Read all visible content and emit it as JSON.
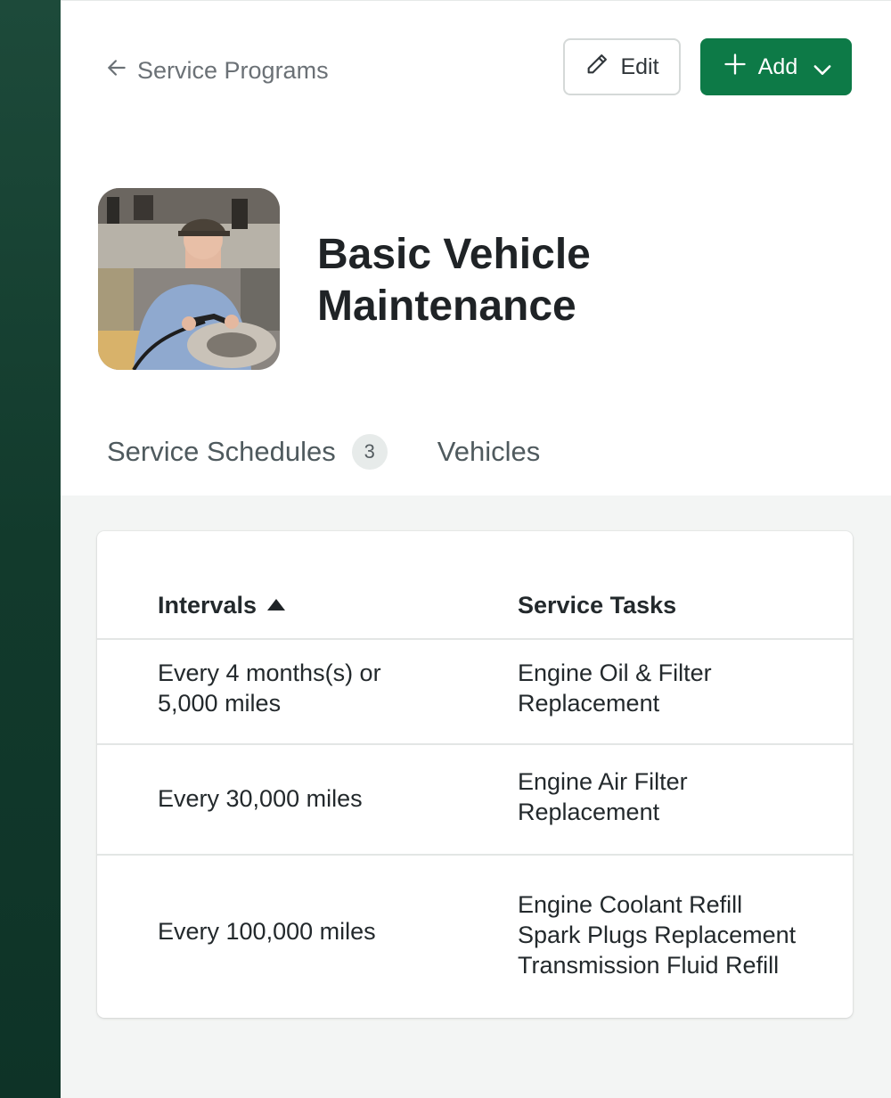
{
  "nav": {
    "back_label": "Service Programs"
  },
  "actions": {
    "edit_label": "Edit",
    "add_label": "Add"
  },
  "program": {
    "title_line1": "Basic Vehicle",
    "title_line2": "Maintenance"
  },
  "tabs": [
    {
      "label": "Service Schedules",
      "count": "3"
    },
    {
      "label": "Vehicles"
    }
  ],
  "table": {
    "headers": {
      "intervals": "Intervals",
      "tasks": "Service Tasks"
    },
    "rows": [
      {
        "interval_line1": "Every 4 months(s) or",
        "interval_line2": "5,000 miles",
        "tasks": [
          "Engine Oil & Filter",
          "Replacement"
        ]
      },
      {
        "interval_line1": "Every 30,000 miles",
        "interval_line2": "",
        "tasks": [
          "Engine Air Filter",
          "Replacement"
        ]
      },
      {
        "interval_line1": "Every 100,000 miles",
        "interval_line2": "",
        "tasks": [
          "Engine Coolant Refill",
          "Spark Plugs Replacement",
          "Transmission Fluid Refill"
        ]
      }
    ]
  },
  "colors": {
    "sidebar": "#123a2c",
    "accent": "#0d7a47",
    "surface": "#f3f5f4"
  },
  "icons": {
    "back": "arrow-left-icon",
    "edit": "pencil-icon",
    "add": "plus-icon",
    "dropdown": "chevron-down-icon",
    "sort": "sort-ascending-icon"
  }
}
